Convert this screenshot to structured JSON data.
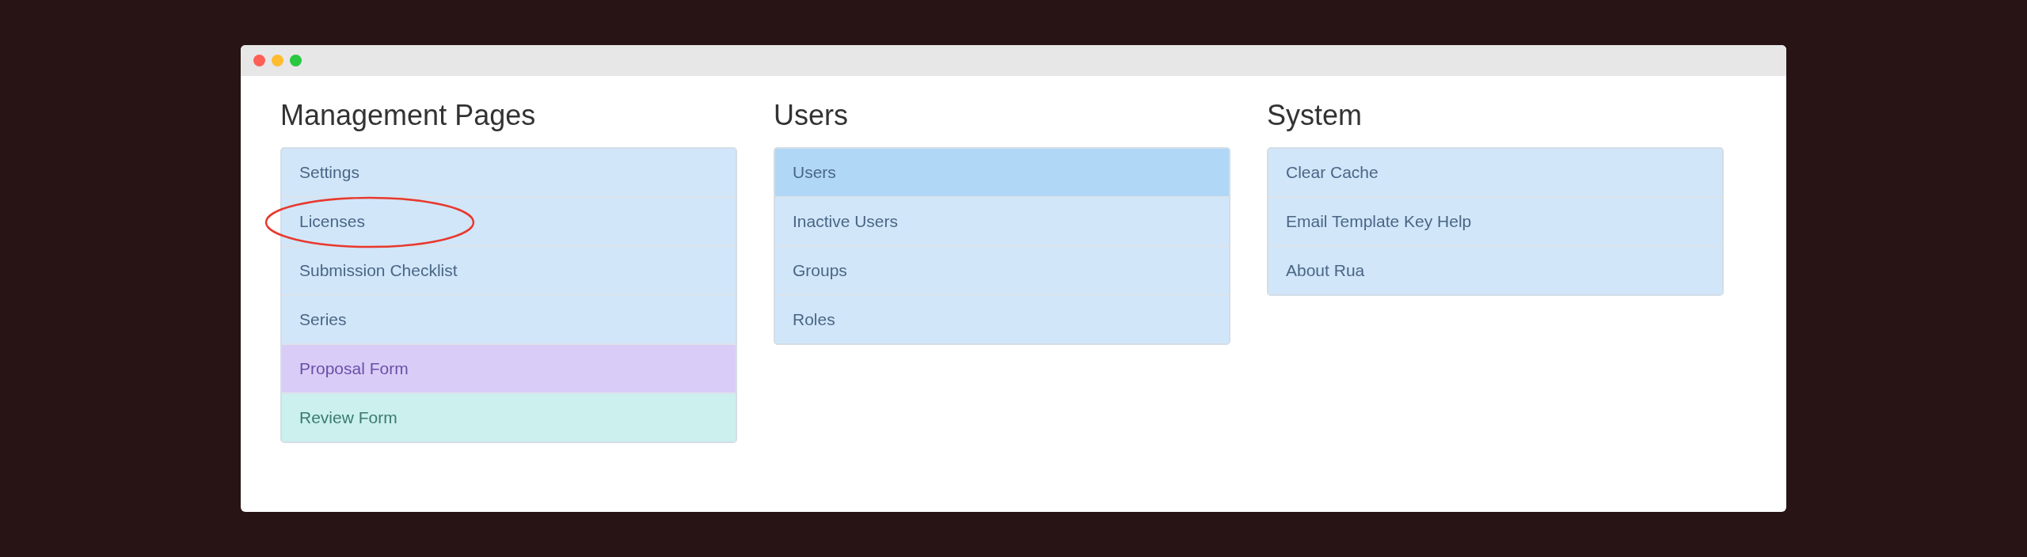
{
  "sections": [
    {
      "title": "Management Pages",
      "items": [
        {
          "label": "Settings",
          "kind": "info",
          "selected": false,
          "circled": false
        },
        {
          "label": "Licenses",
          "kind": "info",
          "selected": false,
          "circled": true
        },
        {
          "label": "Submission Checklist",
          "kind": "info",
          "selected": false,
          "circled": false
        },
        {
          "label": "Series",
          "kind": "info",
          "selected": false,
          "circled": false
        },
        {
          "label": "Proposal Form",
          "kind": "purple",
          "selected": false,
          "circled": false
        },
        {
          "label": "Review Form",
          "kind": "teal",
          "selected": false,
          "circled": false
        }
      ]
    },
    {
      "title": "Users",
      "items": [
        {
          "label": "Users",
          "kind": "info",
          "selected": true,
          "circled": false
        },
        {
          "label": "Inactive Users",
          "kind": "info",
          "selected": false,
          "circled": false
        },
        {
          "label": "Groups",
          "kind": "info",
          "selected": false,
          "circled": false
        },
        {
          "label": "Roles",
          "kind": "info",
          "selected": false,
          "circled": false
        }
      ]
    },
    {
      "title": "System",
      "items": [
        {
          "label": "Clear Cache",
          "kind": "info",
          "selected": false,
          "circled": false
        },
        {
          "label": "Email Template Key Help",
          "kind": "info",
          "selected": false,
          "circled": false
        },
        {
          "label": "About Rua",
          "kind": "info",
          "selected": false,
          "circled": false
        }
      ]
    }
  ]
}
